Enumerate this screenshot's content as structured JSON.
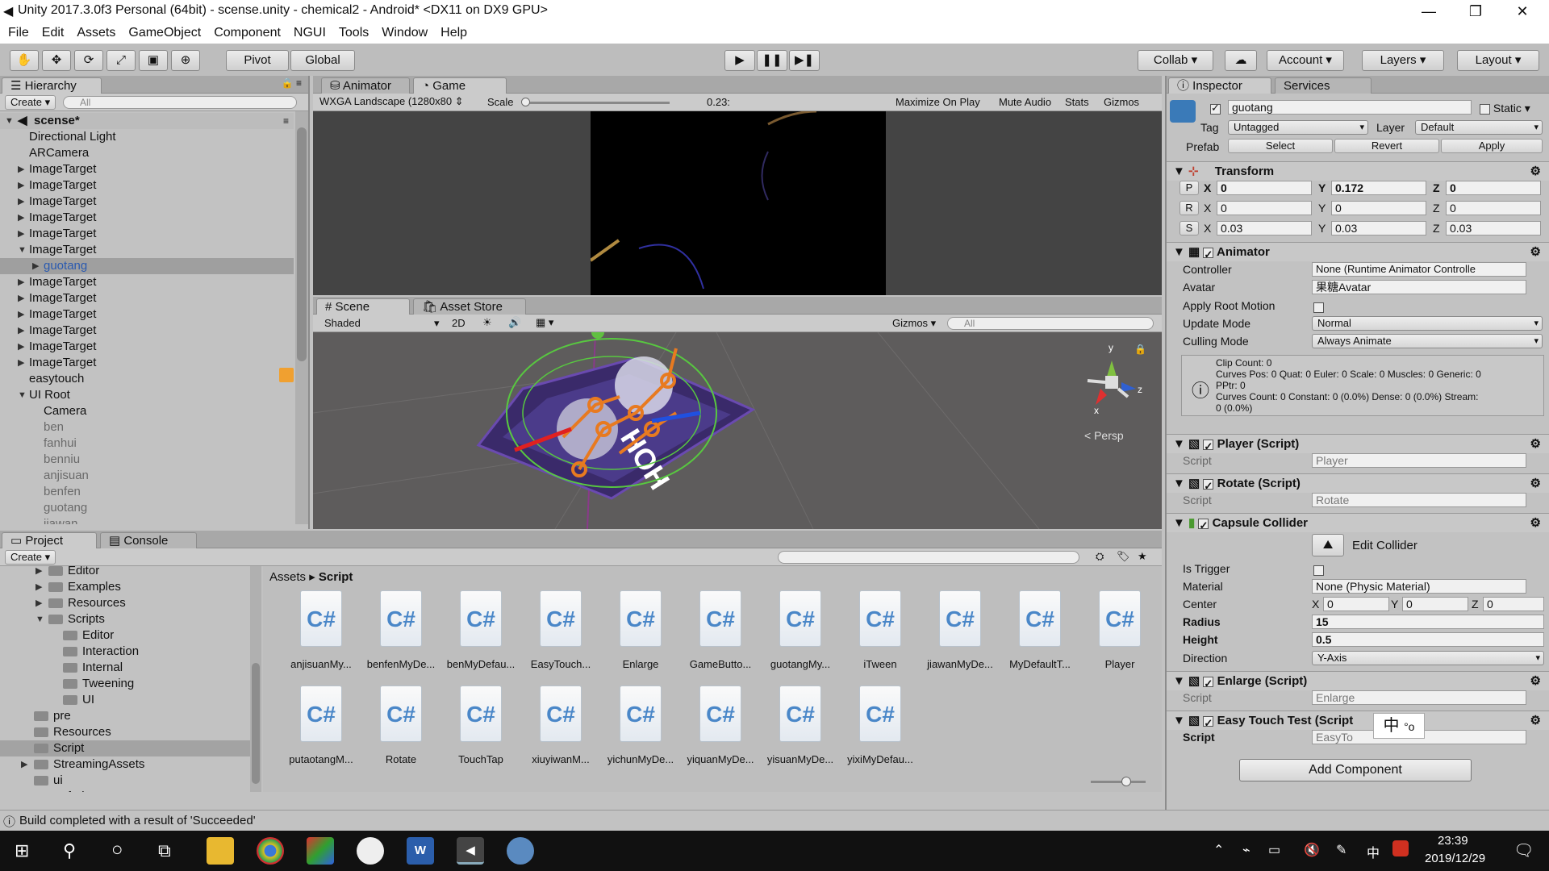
{
  "window": {
    "title": "Unity 2017.3.0f3 Personal (64bit) - scense.unity - chemical2 - Android* <DX11 on DX9 GPU>",
    "minimize": "—",
    "restore": "❐",
    "close": "✕"
  },
  "menu": [
    "File",
    "Edit",
    "Assets",
    "GameObject",
    "Component",
    "NGUI",
    "Tools",
    "Window",
    "Help"
  ],
  "toolbar": {
    "pivot": "Pivot",
    "global": "Global",
    "collab": "Collab ▾",
    "account": "Account",
    "layers": "Layers",
    "layout": "Layout"
  },
  "hierarchy": {
    "tab": "Hierarchy",
    "create": "Create",
    "search": "All",
    "scene": "scense*",
    "items": [
      "Directional Light",
      "ARCamera",
      "ImageTarget",
      "ImageTarget",
      "ImageTarget",
      "ImageTarget",
      "ImageTarget",
      "ImageTarget",
      "guotang",
      "ImageTarget",
      "ImageTarget",
      "ImageTarget",
      "ImageTarget",
      "ImageTarget",
      "ImageTarget",
      "easytouch",
      "UI Root",
      "Camera",
      "ben",
      "fanhui",
      "benniu",
      "anjisuan",
      "benfen",
      "guotang",
      "jiawan"
    ]
  },
  "game": {
    "tab_animator": "Animator",
    "tab_game": "Game",
    "resolution": "WXGA Landscape (1280x80",
    "scale_label": "Scale",
    "scale_value": "0.23:",
    "maximize": "Maximize On Play",
    "mute": "Mute Audio",
    "stats": "Stats",
    "gizmos": "Gizmos"
  },
  "scene": {
    "tab": "Scene",
    "tab_store": "Asset Store",
    "shaded": "Shaded",
    "mode2d": "2D",
    "gizmos": "Gizmos",
    "search": "All",
    "persp": "< Persp",
    "axis_y": "y",
    "axis_x": "x",
    "axis_z": "z"
  },
  "project": {
    "tab": "Project",
    "console_tab": "Console",
    "create": "Create",
    "tree": [
      "Editor",
      "Examples",
      "Resources",
      "Scripts",
      "Editor",
      "Interaction",
      "Internal",
      "Tweening",
      "UI",
      "pre",
      "Resources",
      "Script",
      "StreamingAssets",
      "ui",
      "Vuforia"
    ],
    "breadcrumb_root": "Assets",
    "breadcrumb_leaf": "Script",
    "files_row1": [
      "anjisuanMy...",
      "benfenMyDe...",
      "benMyDefau...",
      "EasyTouch...",
      "Enlarge",
      "GameButto...",
      "guotangMy...",
      "iTween",
      "jiawanMyDe...",
      "MyDefaultT...",
      "Player"
    ],
    "files_row2": [
      "putaotangM...",
      "Rotate",
      "TouchTap",
      "xiuyiwanM...",
      "yichunMyDe...",
      "yiquanMyDe...",
      "yisuanMyDe...",
      "yixiMyDefau..."
    ],
    "cs_glyph": "C#"
  },
  "status": "Build completed with a result of 'Succeeded'",
  "inspector": {
    "tab": "Inspector",
    "services": "Services",
    "name": "guotang",
    "static": "Static",
    "tag_label": "Tag",
    "tag": "Untagged",
    "layer_label": "Layer",
    "layer": "Default",
    "prefab": "Prefab",
    "select": "Select",
    "revert": "Revert",
    "apply": "Apply",
    "transform": {
      "title": "Transform",
      "p": "P",
      "r": "R",
      "s": "S",
      "pos": [
        "0",
        "0.172",
        "0"
      ],
      "rot": [
        "0",
        "0",
        "0"
      ],
      "scale": [
        "0.03",
        "0.03",
        "0.03"
      ]
    },
    "animator": {
      "title": "Animator",
      "controller_label": "Controller",
      "controller": "None (Runtime Animator Controlle",
      "avatar_label": "Avatar",
      "avatar": "果糖Avatar",
      "root_label": "Apply Root Motion",
      "update_label": "Update Mode",
      "update": "Normal",
      "culling_label": "Culling Mode",
      "culling": "Always Animate",
      "info": [
        "Clip Count: 0",
        "Curves Pos: 0 Quat: 0 Euler: 0 Scale: 0 Muscles: 0 Generic: 0",
        "PPtr: 0",
        "Curves Count: 0 Constant: 0 (0.0%) Dense: 0 (0.0%) Stream:",
        "0 (0.0%)"
      ]
    },
    "player": {
      "title": "Player (Script)",
      "script_label": "Script",
      "script": "Player"
    },
    "rotate": {
      "title": "Rotate (Script)",
      "script_label": "Script",
      "script": "Rotate"
    },
    "capsule": {
      "title": "Capsule Collider",
      "edit": "Edit Collider",
      "trigger_label": "Is Trigger",
      "material_label": "Material",
      "material": "None (Physic Material)",
      "center_label": "Center",
      "center": [
        "0",
        "0",
        "0"
      ],
      "radius_label": "Radius",
      "radius": "15",
      "height_label": "Height",
      "height": "0.5",
      "direction_label": "Direction",
      "direction": "Y-Axis"
    },
    "enlarge": {
      "title": "Enlarge (Script)",
      "script_label": "Script",
      "script": "Enlarge"
    },
    "easytouch": {
      "title": "Easy Touch Test (Script",
      "script_label": "Script",
      "script": "EasyTo"
    },
    "add_component": "Add Component"
  },
  "taskbar": {
    "time": "23:39",
    "date": "2019/12/29",
    "ime": "中"
  }
}
